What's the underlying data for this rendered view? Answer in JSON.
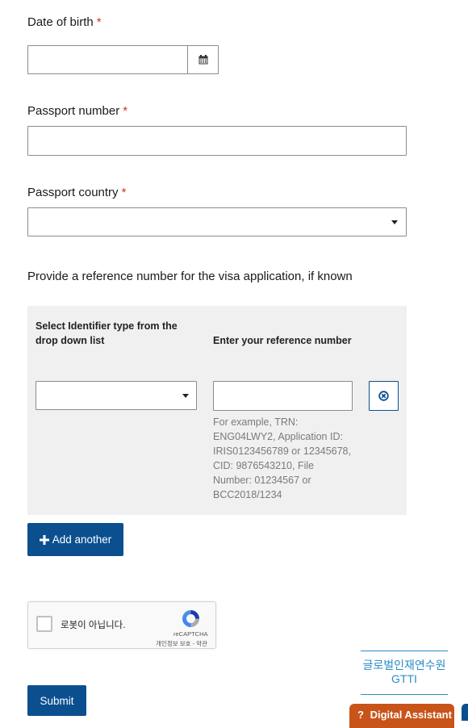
{
  "dob": {
    "label": "Date of birth",
    "required_mark": "*",
    "value": "",
    "calendar_icon": "calendar-icon"
  },
  "passport_number": {
    "label": "Passport number",
    "required_mark": "*",
    "value": ""
  },
  "passport_country": {
    "label": "Passport country",
    "required_mark": "*",
    "selected": ""
  },
  "reference": {
    "heading": "Provide a reference number for the visa application, if known",
    "identifier_type_label": "Select Identifier type from the drop down list",
    "reference_number_label": "Enter your reference number",
    "identifier_selected": "",
    "reference_value": "",
    "hint_lines": [
      "For example, TRN:",
      "ENG04LWY2, Application ID:",
      "IRIS0123456789 or 12345678,",
      "CID: 9876543210, File",
      "Number: 01234567 or",
      "BCC2018/1234"
    ],
    "remove_icon": "remove-circle-icon"
  },
  "add_another": {
    "icon": "plus-icon",
    "label": "Add another"
  },
  "recaptcha": {
    "checkbox_label": "로봇이 아닙니다.",
    "brand": "reCAPTCHA",
    "links": "개인정보 보호 - 약관",
    "logo": "recaptcha-logo"
  },
  "submit": {
    "label": "Submit"
  },
  "gtti": {
    "line1": "글로벌인재연수원",
    "line2": "GTTI"
  },
  "digital_assistant": {
    "icon": "question-icon",
    "mark": "?",
    "label": "Digital Assistant"
  },
  "colors": {
    "primary": "#0b4f8f",
    "required": "#d4351c",
    "gtti": "#2a8dc7",
    "assistant": "#c8541a"
  }
}
